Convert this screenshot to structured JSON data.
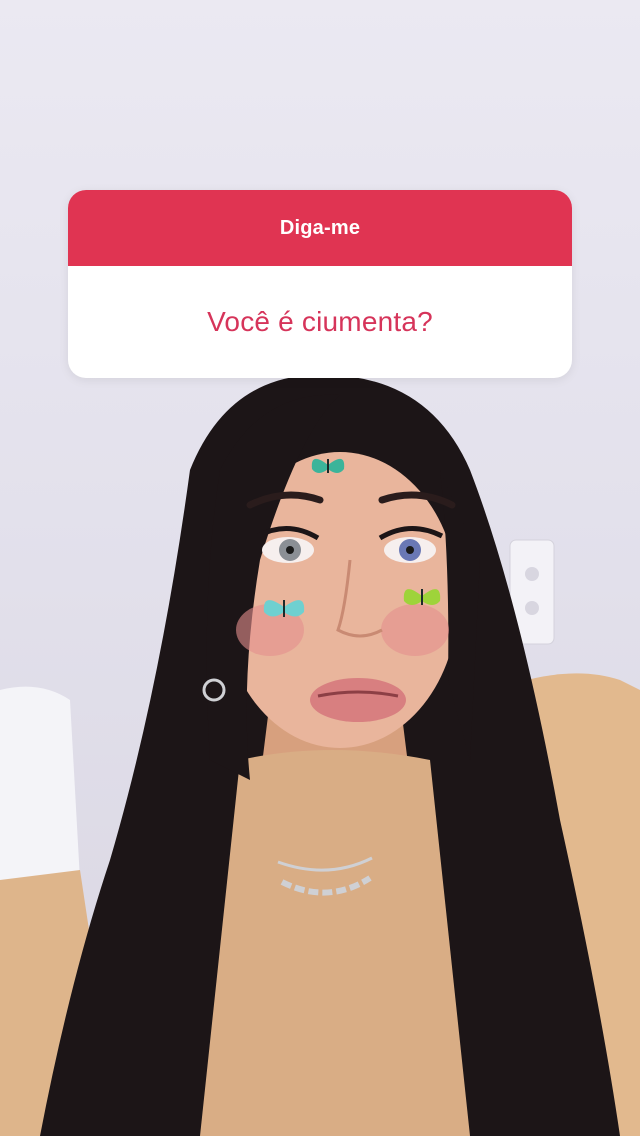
{
  "story": {
    "question_sticker": {
      "header_label": "Diga-me",
      "question_text": "Você é ciumenta?",
      "header_color": "#e03452",
      "question_color": "#d6345a"
    },
    "background": {
      "filter_decorations": [
        "butterfly-icon",
        "butterfly-icon",
        "butterfly-icon"
      ]
    }
  }
}
